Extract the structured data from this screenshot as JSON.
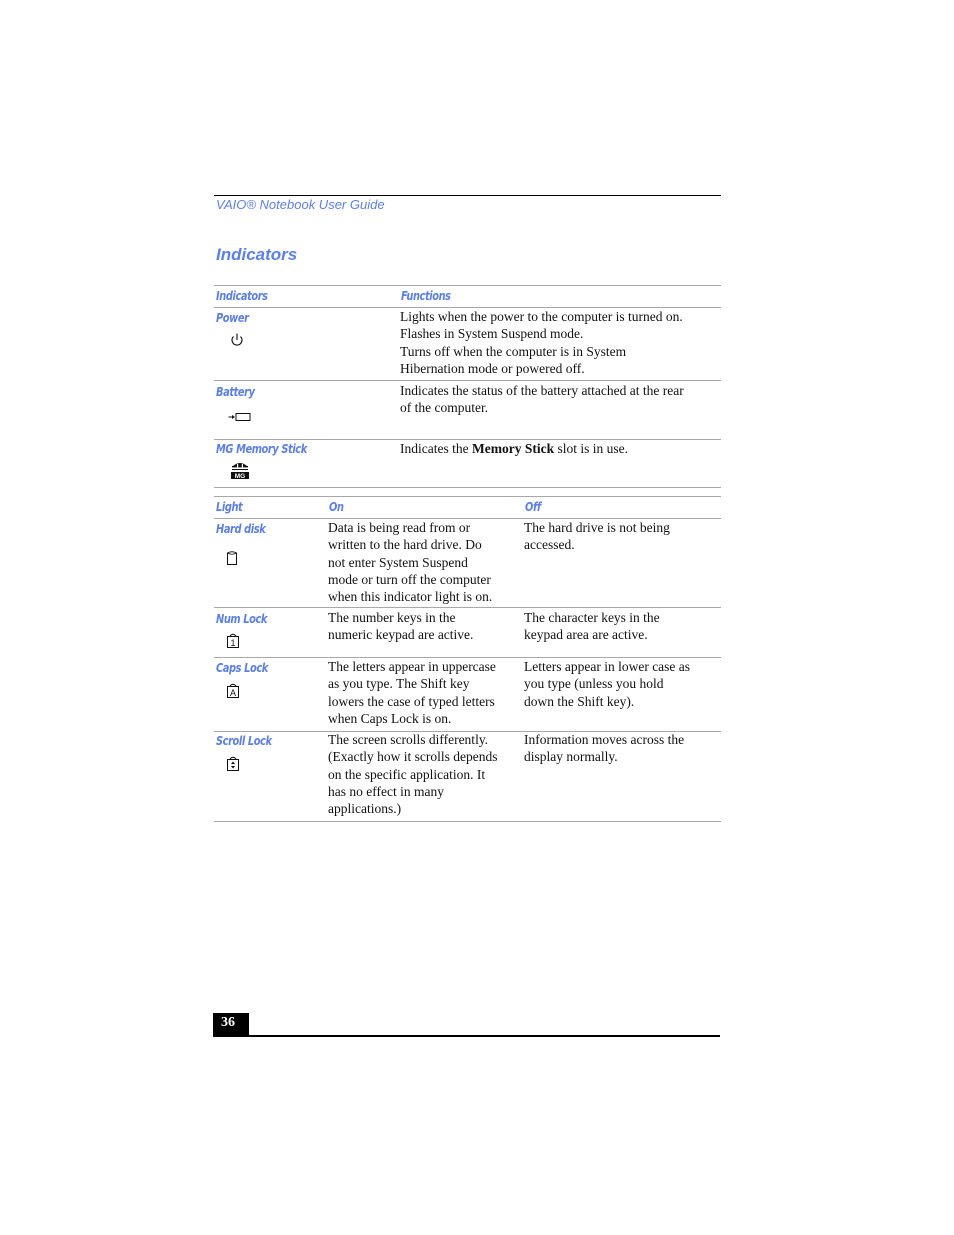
{
  "header": {
    "running_head": "VAIO® Notebook User Guide",
    "section_title": "Indicators"
  },
  "table1": {
    "columns": [
      "Indicators",
      "Functions"
    ],
    "rows": [
      {
        "name": "Power",
        "icon": "power-icon",
        "lines": [
          "Lights when the power to the computer is turned on.",
          "Flashes in System Suspend mode.",
          "Turns off when the computer is in System",
          "Hibernation mode or powered off."
        ]
      },
      {
        "name": "Battery",
        "icon": "battery-icon",
        "lines": [
          "Indicates the status of the battery attached at the rear",
          "of the computer."
        ]
      },
      {
        "name": "MG Memory Stick",
        "icon": "memory-stick-icon",
        "prefix": "Indicates the ",
        "bold": "Memory Stick",
        "suffix": " slot is in use."
      }
    ]
  },
  "table2": {
    "columns": [
      "Light",
      "On",
      "Off"
    ],
    "rows": [
      {
        "name": "Hard disk",
        "icon": "hard-disk-icon",
        "on": [
          "Data is being read from or",
          "written to the hard drive. Do",
          "not enter System Suspend",
          "mode or turn off the computer",
          "when this indicator light is on."
        ],
        "off": [
          "The hard drive is not being",
          "accessed."
        ]
      },
      {
        "name": "Num Lock",
        "icon": "num-lock-icon",
        "on": [
          "The number keys in the",
          "numeric keypad are active."
        ],
        "off": [
          "The character keys in the",
          "keypad area are active."
        ]
      },
      {
        "name": "Caps Lock",
        "icon": "caps-lock-icon",
        "on": [
          "The letters appear in uppercase",
          "as you type. The Shift key",
          "lowers the case of typed letters",
          "when Caps Lock is on."
        ],
        "off": [
          "Letters appear in lower case as",
          "you type (unless you hold",
          "down the Shift key)."
        ]
      },
      {
        "name": "Scroll Lock",
        "icon": "scroll-lock-icon",
        "on": [
          "The screen scrolls differently.",
          "(Exactly how it scrolls depends",
          "on the specific application. It",
          "has no effect in many",
          "applications.)"
        ],
        "off": [
          "Information moves across the",
          "display normally."
        ]
      }
    ]
  },
  "footer": {
    "page_number": "36"
  }
}
